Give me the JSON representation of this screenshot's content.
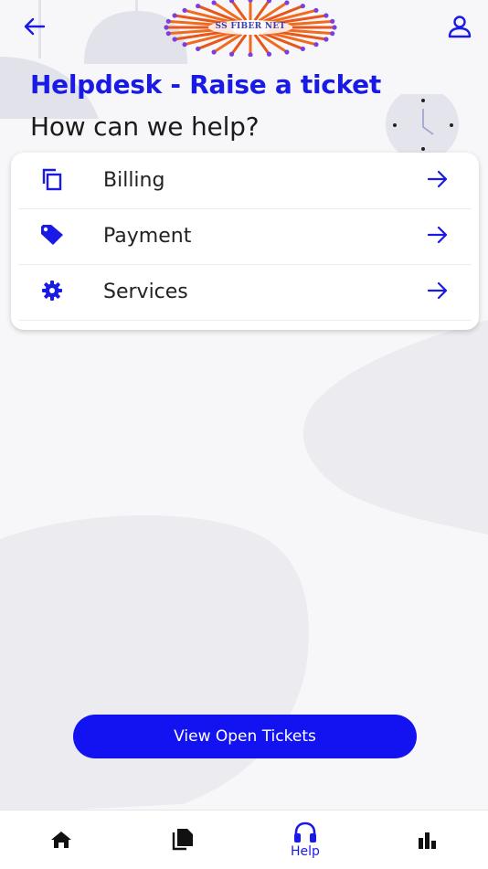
{
  "header": {
    "logo_text": "SS FIBER NET",
    "back_icon": "arrow-left-icon",
    "profile_icon": "person-icon"
  },
  "page": {
    "title": "Helpdesk - Raise a ticket",
    "subtitle": "How can we help?"
  },
  "categories": [
    {
      "label": "Billing",
      "icon": "copy-icon"
    },
    {
      "label": "Payment",
      "icon": "tag-icon"
    },
    {
      "label": "Services",
      "icon": "gear-icon"
    }
  ],
  "actions": {
    "view_open_tickets": "View Open Tickets"
  },
  "bottom_nav": {
    "items": [
      {
        "icon": "home-icon",
        "label": ""
      },
      {
        "icon": "documents-icon",
        "label": ""
      },
      {
        "icon": "headphones-icon",
        "label": "Help",
        "active": true
      },
      {
        "icon": "bar-chart-icon",
        "label": ""
      }
    ]
  },
  "colors": {
    "accent": "#1313f2",
    "title": "#1a1ae6",
    "logo_orange": "#f26a1b",
    "logo_purple": "#7b3fe0"
  }
}
